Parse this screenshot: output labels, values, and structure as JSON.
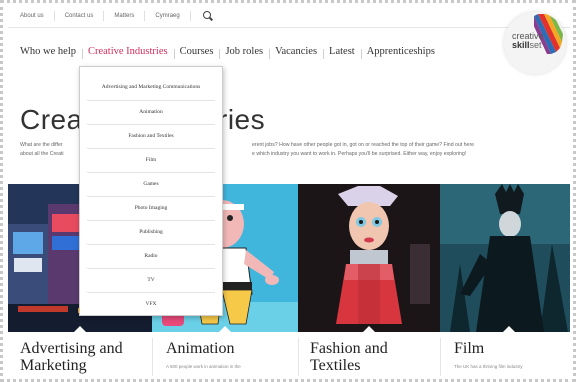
{
  "utility_nav": {
    "items": [
      "About us",
      "Contact us",
      "Matters",
      "Cymraeg"
    ]
  },
  "main_nav": {
    "items": [
      {
        "label": "Who we help",
        "active": false
      },
      {
        "label": "Creative Industries",
        "active": true
      },
      {
        "label": "Courses",
        "active": false
      },
      {
        "label": "Job roles",
        "active": false
      },
      {
        "label": "Vacancies",
        "active": false
      },
      {
        "label": "Latest",
        "active": false
      },
      {
        "label": "Apprenticeships",
        "active": false
      }
    ],
    "active_color": "#d12f5c"
  },
  "logo": {
    "word1": "creative",
    "word2_bold": "skill",
    "word2_rest": "set"
  },
  "hero": {
    "title_left": "Crea",
    "title_right": "ries",
    "intro_1": "What are the differ",
    "intro_2": "erent jobs? How have other people got in, got on or reached the top of their game? Find out here",
    "intro_3": "about all the Creati",
    "intro_4": "e which industry you want to work in. Perhaps you'll be surprised. Either way, enjoy exploring!"
  },
  "dropdown": {
    "items": [
      "Advertising and Marketing Communications",
      "Animation",
      "Fashion and Textiles",
      "Film",
      "Games",
      "Photo Imaging",
      "Publishing",
      "Radio",
      "TV",
      "VFX"
    ]
  },
  "tiles": [
    {
      "label": "Advertising and Marketing",
      "sub": ""
    },
    {
      "label": "Animation",
      "sub": "A 500 people work in animation in the"
    },
    {
      "label": "Fashion and Textiles",
      "sub": ""
    },
    {
      "label": "Film",
      "sub": "The UK has a thriving film industry"
    }
  ],
  "colors": {
    "accent": "#d12f5c",
    "text": "#333333"
  }
}
